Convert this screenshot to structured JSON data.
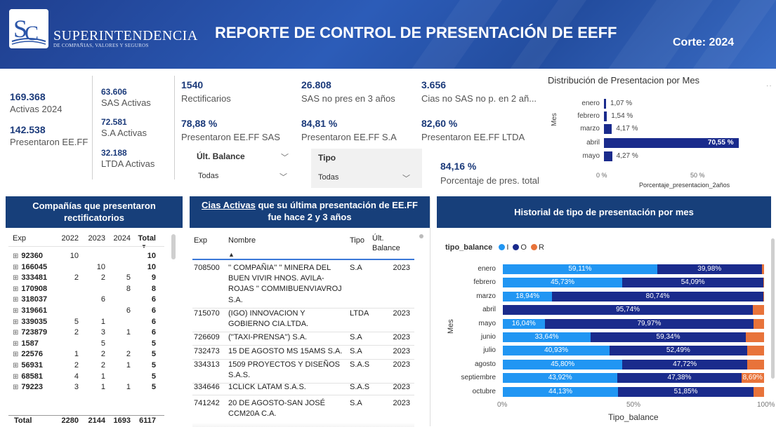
{
  "header": {
    "brand_title": "SUPERINTENDENCIA",
    "brand_sub": "DE COMPAÑIAS, VALORES Y SEGUROS",
    "title": "REPORTE DE CONTROL DE PRESENTACIÓN DE EEFF",
    "corte": "Corte: 2024"
  },
  "kpis": {
    "activas_value": "169.368",
    "activas_label": "Activas 2024",
    "presentaron_value": "142.538",
    "presentaron_label": "Presentaron EE.FF",
    "sas_value": "63.606",
    "sas_label": "SAS Activas",
    "sa_value": "72.581",
    "sa_label": "S.A Activas",
    "ltda_value": "32.188",
    "ltda_label": "LTDA Activas",
    "rect_value": "1540",
    "rect_label": "Rectificarios",
    "sasnop_value": "26.808",
    "sasnop_label": "SAS no pres en 3 años",
    "ciasnosas_value": "3.656",
    "ciasnosas_label": "Cias no SAS no p. en 2 añ...",
    "pres_sas_value": "78,88 %",
    "pres_sas_label": "Presentaron EE.FF SAS",
    "pres_sa_value": "84,81 %",
    "pres_sa_label": "Presentaron EE.FF S.A",
    "pres_ltda_value": "82,60 %",
    "pres_ltda_label": "Presentaron EE.FF LTDA",
    "total_value": "84,16 %",
    "total_label": "Porcentaje de pres. total"
  },
  "slicers": {
    "balance_title": "Últ. Balance",
    "balance_value": "Todas",
    "tipo_title": "Tipo",
    "tipo_value": "Todas"
  },
  "distribucion": {
    "title": "Distribución de Presentacion por Mes",
    "ylabel": "Mes",
    "xlabel": "Porcentaje_presentacion_2años",
    "tick0": "0 %",
    "tick50": "50 %",
    "months": [
      "enero",
      "febrero",
      "marzo",
      "abril",
      "mayo"
    ],
    "values": [
      1.07,
      1.54,
      4.17,
      70.55,
      4.27
    ],
    "labels": [
      "1,07 %",
      "1,54 %",
      "4,17 %",
      "70,55 %",
      "4,27 %"
    ],
    "color": "#1a2b8c"
  },
  "rect_table": {
    "title": "Compañías que presentaron rectificatorios",
    "headers": [
      "Exp",
      "2022",
      "2023",
      "2024",
      "Total"
    ],
    "rows": [
      [
        "92360",
        "10",
        "",
        "",
        "10"
      ],
      [
        "166045",
        "",
        "10",
        "",
        "10"
      ],
      [
        "333481",
        "2",
        "2",
        "5",
        "9"
      ],
      [
        "170908",
        "",
        "",
        "8",
        "8"
      ],
      [
        "318037",
        "",
        "6",
        "",
        "6"
      ],
      [
        "319661",
        "",
        "",
        "6",
        "6"
      ],
      [
        "339035",
        "5",
        "1",
        "",
        "6"
      ],
      [
        "723879",
        "2",
        "3",
        "1",
        "6"
      ],
      [
        "1587",
        "",
        "5",
        "",
        "5"
      ],
      [
        "22576",
        "1",
        "2",
        "2",
        "5"
      ],
      [
        "56931",
        "2",
        "2",
        "1",
        "5"
      ],
      [
        "68581",
        "4",
        "1",
        "",
        "5"
      ],
      [
        "79223",
        "3",
        "1",
        "1",
        "5"
      ]
    ],
    "total": [
      "Total",
      "2280",
      "2144",
      "1693",
      "6117"
    ]
  },
  "cias_table": {
    "title_link": "Cias Activas",
    "title_rest": " que su última presentación de EE.FF",
    "title_line2": "fue hace 2 y 3 años",
    "headers": [
      "Exp",
      "Nombre",
      "Tipo",
      "Últ. Balance"
    ],
    "rows": [
      {
        "exp": "708500",
        "nombre": [
          "'' COMPAÑIA'' '' MINERA DEL",
          "BUEN VIVIR HNOS. AVILA-",
          "ROJAS '' COMMIBUENVIAVROJ",
          "S.A."
        ],
        "tipo": "S.A",
        "bal": "2023"
      },
      {
        "exp": "715070",
        "nombre": [
          "(IGO) INNOVACION Y",
          "GOBIERNO CIA.LTDA."
        ],
        "tipo": "LTDA",
        "bal": "2023"
      },
      {
        "exp": "726609",
        "nombre": [
          "(''TAXI-PRENSA'') S.A."
        ],
        "tipo": "S.A",
        "bal": "2023"
      },
      {
        "exp": "732473",
        "nombre": [
          "15 DE AGOSTO MS 15AMS S.A."
        ],
        "tipo": "S.A",
        "bal": "2023"
      },
      {
        "exp": "334313",
        "nombre": [
          "1509 PROYECTOS Y DISEÑOS",
          "S.A.S."
        ],
        "tipo": "S.A.S",
        "bal": "2023"
      },
      {
        "exp": "334646",
        "nombre": [
          "1CLICK LATAM S.A.S."
        ],
        "tipo": "S.A.S",
        "bal": "2023"
      },
      {
        "exp": "741242",
        "nombre": [
          "20 DE AGOSTO-SAN JOSÉ",
          "CCM20A C.A."
        ],
        "tipo": "S.A",
        "bal": "2023"
      }
    ]
  },
  "historial": {
    "title": "Historial de tipo de presentación por mes",
    "legend_title": "tipo_balance",
    "legend": [
      {
        "name": "I",
        "color": "#2196f3"
      },
      {
        "name": "O",
        "color": "#1a2b8c"
      },
      {
        "name": "R",
        "color": "#e8733a"
      }
    ],
    "ylabel": "Mes",
    "xlabel": "Tipo_balance",
    "ticks": [
      "0%",
      "50%",
      "100%"
    ]
  },
  "chart_data": {
    "type": "bar",
    "title": "Historial de tipo de presentación por mes",
    "xlabel": "Tipo_balance",
    "ylabel": "Mes",
    "xlim": [
      0,
      100
    ],
    "categories": [
      "enero",
      "febrero",
      "marzo",
      "abril",
      "mayo",
      "junio",
      "julio",
      "agosto",
      "septiembre",
      "octubre"
    ],
    "series": [
      {
        "name": "I",
        "values": [
          59.11,
          45.73,
          18.94,
          0.0,
          16.04,
          33.64,
          40.93,
          45.8,
          43.92,
          44.13
        ]
      },
      {
        "name": "O",
        "values": [
          39.98,
          54.09,
          80.74,
          95.74,
          79.97,
          59.34,
          52.49,
          47.72,
          47.38,
          51.85
        ]
      },
      {
        "name": "R",
        "values": [
          0.91,
          0.18,
          0.32,
          4.26,
          3.99,
          7.02,
          6.58,
          6.48,
          8.69,
          4.02
        ]
      }
    ],
    "labels": {
      "I": [
        "59,11%",
        "45,73%",
        "18,94%",
        "",
        "16,04%",
        "33,64%",
        "40,93%",
        "45,80%",
        "43,92%",
        "44,13%"
      ],
      "O": [
        "39,98%",
        "54,09%",
        "80,74%",
        "95,74%",
        "79,97%",
        "59,34%",
        "52,49%",
        "47,72%",
        "47,38%",
        "51,85%"
      ],
      "R": [
        "",
        "",
        "",
        "",
        "",
        "",
        "",
        "",
        "8,69%",
        ""
      ]
    }
  }
}
